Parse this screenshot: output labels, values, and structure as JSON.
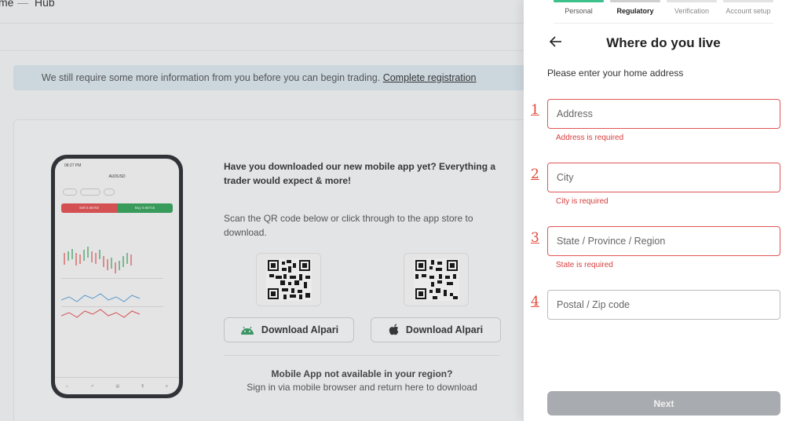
{
  "background": {
    "breadcrumb_1": "me",
    "breadcrumb_2": "Hub",
    "notice_text": "We still require some more information from you before you can begin trading. ",
    "notice_link": "Complete registration",
    "promo_text": "Have you downloaded our new mobile app yet? Everything a trader would expect & more!",
    "scan_text": "Scan the QR code below or click through to the app store to download.",
    "download_android_label": "Download Alpari",
    "download_ios_label": "Download Alpari",
    "not_available_title": "Mobile App not available in your region?",
    "not_available_sub": "Sign in via mobile browser and return here to download",
    "phone": {
      "time": "08:27 PM",
      "pair": "AUDUSD",
      "sell": "Sell 0.66702",
      "buy": "Buy 0.66715"
    }
  },
  "panel": {
    "steps": [
      {
        "label": "Personal",
        "state": "done"
      },
      {
        "label": "Regulatory",
        "state": "active"
      },
      {
        "label": "Verification",
        "state": "todo"
      },
      {
        "label": "Account setup",
        "state": "todo"
      }
    ],
    "title": "Where do you live",
    "intro": "Please enter your home address",
    "fields": [
      {
        "marker": "1",
        "placeholder": "Address",
        "value": "",
        "error": "Address is required"
      },
      {
        "marker": "2",
        "placeholder": "City",
        "value": "",
        "error": "City is required"
      },
      {
        "marker": "3",
        "placeholder": "State / Province / Region",
        "value": "",
        "error": "State is required"
      },
      {
        "marker": "4",
        "placeholder": "Postal / Zip code",
        "value": "",
        "error": ""
      }
    ],
    "next_label": "Next"
  },
  "colors": {
    "accent_green": "#3cc08c",
    "error_red": "#e05555",
    "annotation_red": "#e04a3a",
    "button_disabled": "#a8abaf"
  }
}
